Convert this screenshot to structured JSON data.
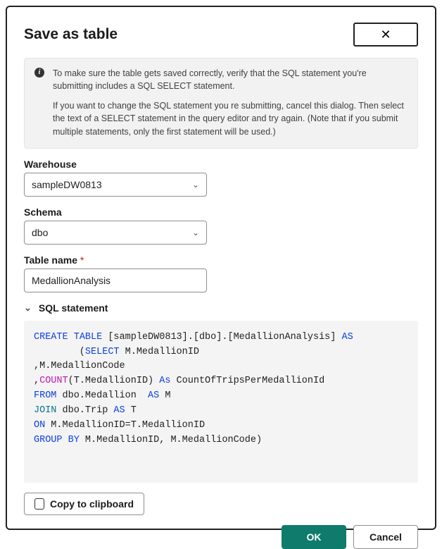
{
  "dialog": {
    "title": "Save as table",
    "close_label": "✕"
  },
  "info": {
    "para1": "To make sure the table gets saved correctly, verify that the SQL statement you're submitting includes a SQL SELECT statement.",
    "para2": "If you want to change the SQL statement you re submitting, cancel this dialog. Then select the text of a SELECT statement in the query editor and try again. (Note that if you submit multiple statements, only the first statement will be used.)"
  },
  "warehouse": {
    "label": "Warehouse",
    "value": "sampleDW0813"
  },
  "schema": {
    "label": "Schema",
    "value": "dbo"
  },
  "table": {
    "label": "Table name",
    "required_mark": "*",
    "value": "MedallionAnalysis"
  },
  "sql": {
    "label": "SQL statement",
    "tokens": [
      {
        "c": "kw-blue",
        "t": "CREATE"
      },
      {
        "c": "",
        "t": " "
      },
      {
        "c": "kw-blue",
        "t": "TABLE"
      },
      {
        "c": "",
        "t": " [sampleDW0813].[dbo].[MedallionAnalysis] "
      },
      {
        "c": "kw-blue",
        "t": "AS"
      },
      {
        "c": "",
        "t": "\n        ("
      },
      {
        "c": "kw-blue",
        "t": "SELECT"
      },
      {
        "c": "",
        "t": " M.MedallionID\n,M.MedallionCode\n,"
      },
      {
        "c": "kw-mag",
        "t": "COUNT"
      },
      {
        "c": "",
        "t": "(T.MedallionID) "
      },
      {
        "c": "kw-blue",
        "t": "As"
      },
      {
        "c": "",
        "t": " CountOfTripsPerMedallionId\n"
      },
      {
        "c": "kw-blue",
        "t": "FROM"
      },
      {
        "c": "",
        "t": " dbo.Medallion  "
      },
      {
        "c": "kw-blue",
        "t": "AS"
      },
      {
        "c": "",
        "t": " M\n"
      },
      {
        "c": "kw-cy",
        "t": "JOIN"
      },
      {
        "c": "",
        "t": " dbo.Trip "
      },
      {
        "c": "kw-blue",
        "t": "AS"
      },
      {
        "c": "",
        "t": " T\n"
      },
      {
        "c": "kw-blue",
        "t": "ON"
      },
      {
        "c": "",
        "t": " M.MedallionID=T.MedallionID\n"
      },
      {
        "c": "kw-blue",
        "t": "GROUP"
      },
      {
        "c": "",
        "t": " "
      },
      {
        "c": "kw-blue",
        "t": "BY"
      },
      {
        "c": "",
        "t": " M.MedallionID, M.MedallionCode)"
      }
    ]
  },
  "copy": {
    "label": "Copy to clipboard"
  },
  "footer": {
    "ok": "OK",
    "cancel": "Cancel"
  }
}
